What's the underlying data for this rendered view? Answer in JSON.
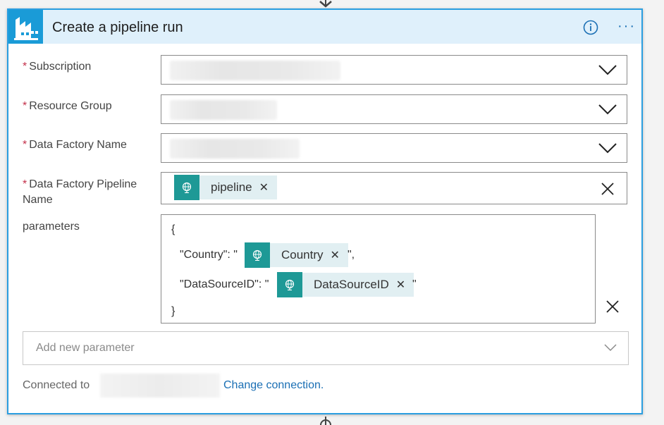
{
  "header": {
    "title": "Create a pipeline run",
    "info_icon": "info-icon",
    "more_icon": "more-icon",
    "app_icon": "data-factory-icon",
    "accent_color": "#1a9bd7"
  },
  "fields": [
    {
      "label": "Subscription",
      "required": true,
      "value": ""
    },
    {
      "label": "Resource Group",
      "required": true,
      "value": ""
    },
    {
      "label": "Data Factory Name",
      "required": true,
      "value": ""
    },
    {
      "label_line1": "Data Factory Pipeline",
      "label_line2": "Name",
      "required": true,
      "token": "pipeline"
    }
  ],
  "parameters": {
    "label": "parameters",
    "open_brace": "{",
    "close_brace": "}",
    "line1_prefix": "\"Country\": \"",
    "line1_token": "Country",
    "line1_suffix": "\",",
    "line2_prefix": "\"DataSourceID\": \"",
    "line2_token": "DataSourceID",
    "line2_suffix": "\""
  },
  "add_parameter": {
    "placeholder": "Add new parameter"
  },
  "connection": {
    "label": "Connected to",
    "link": "Change connection."
  },
  "token_color": "#1e9996",
  "required_marker": "*"
}
